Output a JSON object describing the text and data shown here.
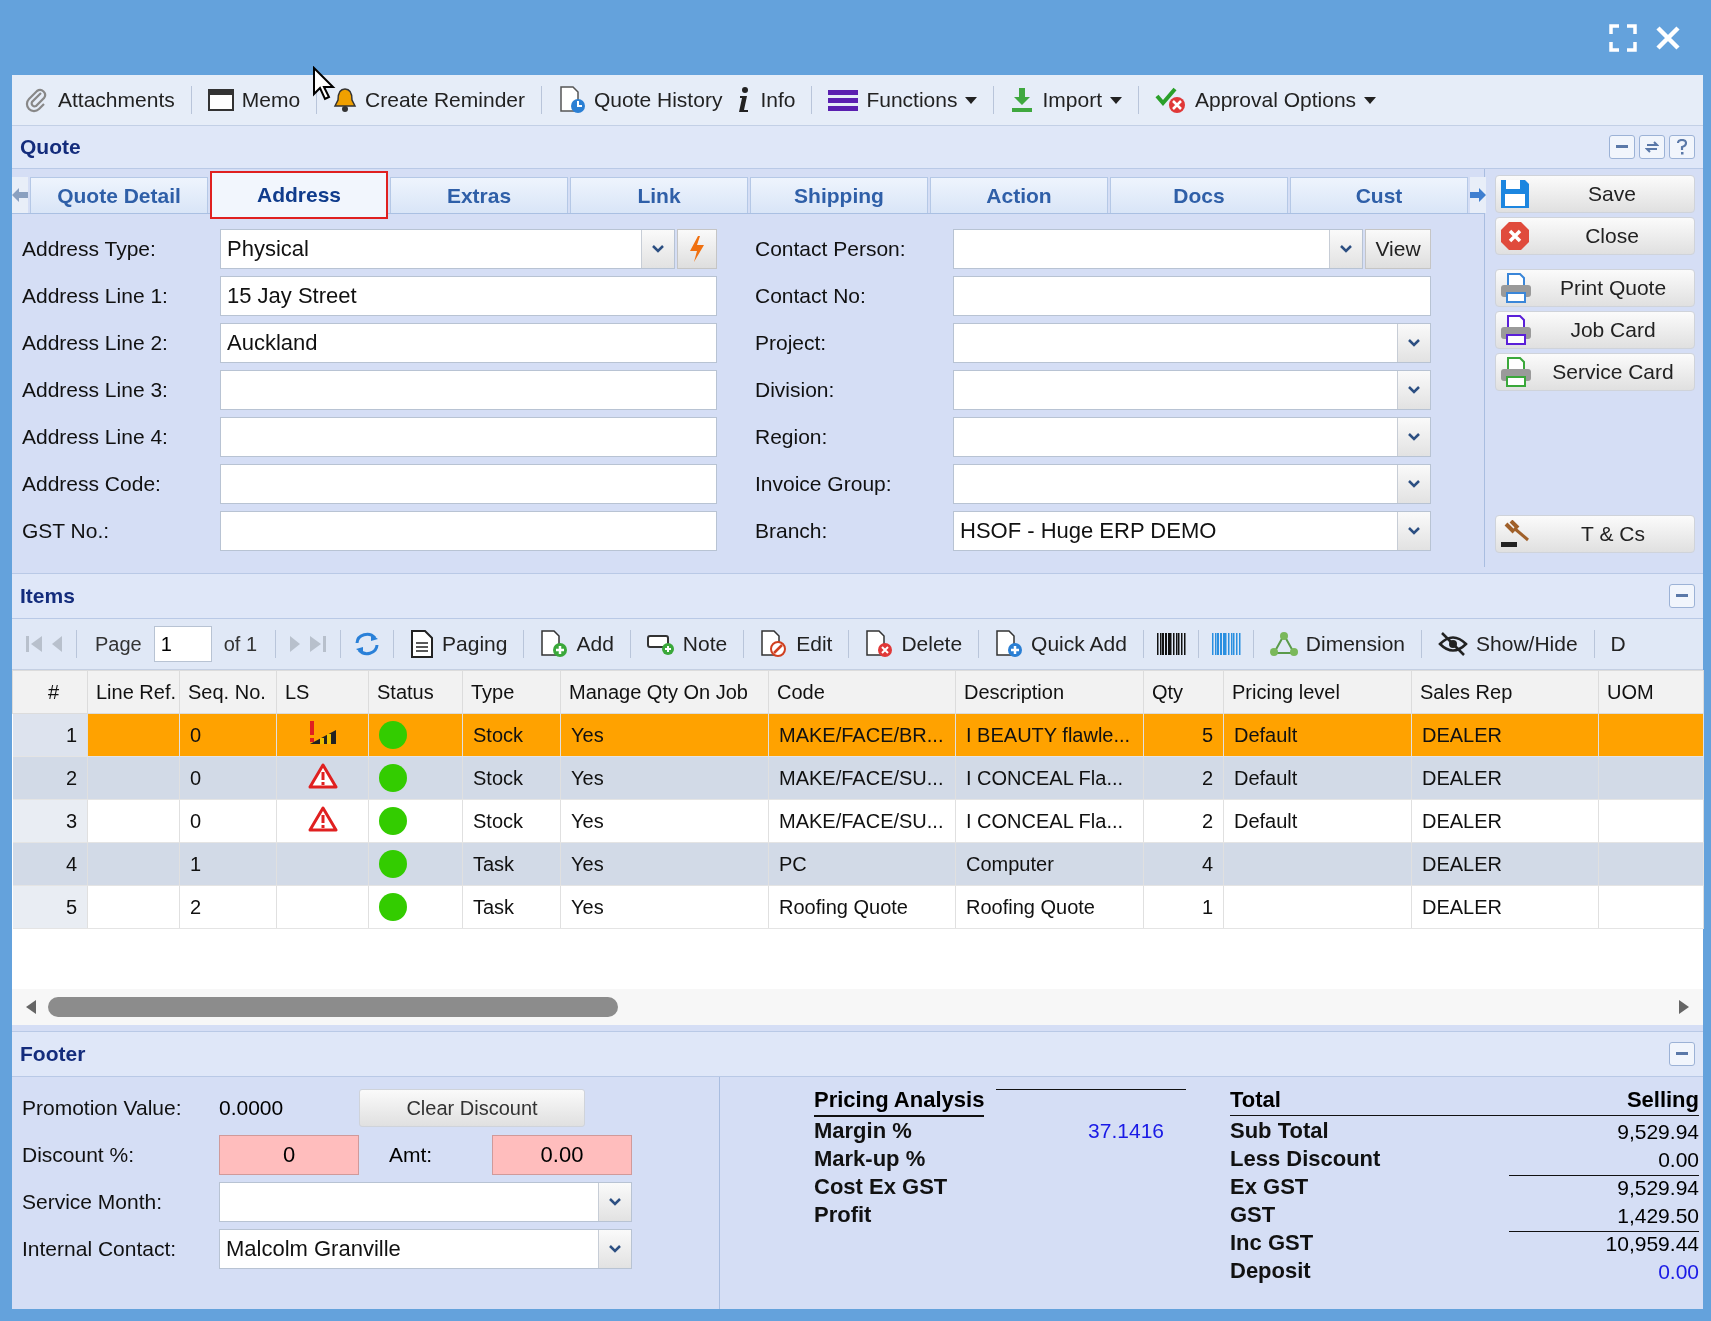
{
  "toolbar": [
    {
      "label": "Attachments",
      "dropdown": false
    },
    {
      "label": "Memo",
      "dropdown": false
    },
    {
      "label": "Create Reminder",
      "dropdown": false
    },
    {
      "label": "Quote History",
      "dropdown": false
    },
    {
      "label": "Info",
      "dropdown": false
    },
    {
      "label": "Functions",
      "dropdown": true
    },
    {
      "label": "Import",
      "dropdown": true
    },
    {
      "label": "Approval Options",
      "dropdown": true
    }
  ],
  "panel": {
    "title": "Quote"
  },
  "tabs": [
    {
      "label": "Quote Detail",
      "selected": false
    },
    {
      "label": "Address",
      "selected": true
    },
    {
      "label": "Extras",
      "selected": false
    },
    {
      "label": "Link",
      "selected": false
    },
    {
      "label": "Shipping",
      "selected": false
    },
    {
      "label": "Action",
      "selected": false
    },
    {
      "label": "Docs",
      "selected": false
    },
    {
      "label": "Cust",
      "selected": false
    }
  ],
  "address_form": {
    "left": [
      {
        "label": "Address Type:",
        "kind": "combo_action",
        "value": "Physical"
      },
      {
        "label": "Address Line 1:",
        "kind": "text",
        "value": "15 Jay Street"
      },
      {
        "label": "Address Line 2:",
        "kind": "text",
        "value": "Auckland"
      },
      {
        "label": "Address Line 3:",
        "kind": "text"
      },
      {
        "label": "Address Line 4:",
        "kind": "text"
      },
      {
        "label": "Address Code:",
        "kind": "text"
      },
      {
        "label": "GST No.:",
        "kind": "text"
      }
    ],
    "right": [
      {
        "label": "Contact Person:",
        "kind": "combo_button",
        "button": "View"
      },
      {
        "label": "Contact No:",
        "kind": "text"
      },
      {
        "label": "Project:",
        "kind": "combo"
      },
      {
        "label": "Division:",
        "kind": "combo"
      },
      {
        "label": "Region:",
        "kind": "combo"
      },
      {
        "label": "Invoice Group:",
        "kind": "combo"
      },
      {
        "label": "Branch:",
        "kind": "combo",
        "value": "HSOF - Huge ERP DEMO"
      }
    ]
  },
  "side_buttons": [
    {
      "label": "Save"
    },
    {
      "label": "Close"
    },
    {
      "label": "Print Quote"
    },
    {
      "label": "Job Card"
    },
    {
      "label": "Service Card"
    },
    {
      "label": "T & Cs"
    }
  ],
  "items": {
    "title": "Items",
    "pager": {
      "label": "Page",
      "page": "1",
      "of": "of 1"
    },
    "tools": [
      {
        "kind": "button",
        "label": "Paging"
      },
      {
        "kind": "button",
        "label": "Add"
      },
      {
        "kind": "button",
        "label": "Note"
      },
      {
        "kind": "button",
        "label": "Edit"
      },
      {
        "kind": "button",
        "label": "Delete"
      },
      {
        "kind": "button",
        "label": "Quick Add"
      },
      {
        "kind": "icon"
      },
      {
        "kind": "icon"
      },
      {
        "kind": "button",
        "label": "Dimension"
      },
      {
        "kind": "button",
        "label": "Show/Hide"
      },
      {
        "kind": "button",
        "label": "D"
      }
    ],
    "columns": [
      "#",
      "Line Ref.",
      "Seq. No.",
      "LS",
      "Status",
      "Type",
      "Manage Qty On Job",
      "Code",
      "Description",
      "Qty",
      "Pricing level",
      "Sales Rep",
      "UOM"
    ],
    "rows": [
      {
        "selected": true,
        "num": "1",
        "seq": "0",
        "low_stock": true,
        "warning": false,
        "color": "#33cc00",
        "type": "Stock",
        "manage": "Yes",
        "code": "MAKE/FACE/BR...",
        "description": "I BEAUTY flawle...",
        "qty": "5",
        "pricing": "Default",
        "sales_rep": "DEALER"
      },
      {
        "selected": false,
        "num": "2",
        "seq": "0",
        "low_stock": false,
        "warning": true,
        "color": "#33cc00",
        "type": "Stock",
        "manage": "Yes",
        "code": "MAKE/FACE/SU...",
        "description": "I CONCEAL Fla...",
        "qty": "2",
        "pricing": "Default",
        "sales_rep": "DEALER"
      },
      {
        "selected": false,
        "num": "3",
        "seq": "0",
        "low_stock": false,
        "warning": true,
        "color": "#33cc00",
        "type": "Stock",
        "manage": "Yes",
        "code": "MAKE/FACE/SU...",
        "description": "I CONCEAL Fla...",
        "qty": "2",
        "pricing": "Default",
        "sales_rep": "DEALER"
      },
      {
        "selected": false,
        "num": "4",
        "seq": "1",
        "low_stock": false,
        "warning": false,
        "color": "#33cc00",
        "type": "Task",
        "manage": "Yes",
        "code": "PC",
        "description": "Computer",
        "qty": "4",
        "sales_rep": "DEALER"
      },
      {
        "selected": false,
        "num": "5",
        "seq": "2",
        "low_stock": false,
        "warning": false,
        "color": "#33cc00",
        "type": "Task",
        "manage": "Yes",
        "code": "Roofing Quote",
        "description": "Roofing Quote",
        "qty": "1",
        "sales_rep": "DEALER"
      }
    ]
  },
  "footer": {
    "title": "Footer",
    "promotion": {
      "label": "Promotion Value:",
      "value": "0.0000",
      "button": "Clear Discount"
    },
    "discount": {
      "label": "Discount %:",
      "value": "0",
      "amt_label": "Amt:",
      "amt": "0.00"
    },
    "service_month": {
      "label": "Service Month:"
    },
    "internal_contact": {
      "label": "Internal Contact:",
      "value": "Malcolm Granville"
    },
    "analysis": {
      "title": "Pricing Analysis",
      "rows": [
        {
          "label": "Margin %",
          "value": "37.1416"
        },
        {
          "label": "Mark-up %"
        },
        {
          "label": "Cost Ex GST"
        },
        {
          "label": "Profit"
        }
      ]
    },
    "totals": {
      "title": "Total",
      "column": "Selling",
      "rows": [
        {
          "label": "Sub Total",
          "value": "9,529.94",
          "rule_above": false,
          "linked": false
        },
        {
          "label": "Less Discount",
          "value": "0.00",
          "rule_above": false,
          "linked": false
        },
        {
          "label": "Ex GST",
          "value": "9,529.94",
          "rule_above": true,
          "linked": false
        },
        {
          "label": "GST",
          "value": "1,429.50",
          "rule_above": false,
          "linked": false
        },
        {
          "label": "Inc GST",
          "value": "10,959.44",
          "rule_above": true,
          "linked": false
        },
        {
          "label": "Deposit",
          "value": "0.00",
          "rule_above": false,
          "linked": true
        }
      ]
    }
  }
}
